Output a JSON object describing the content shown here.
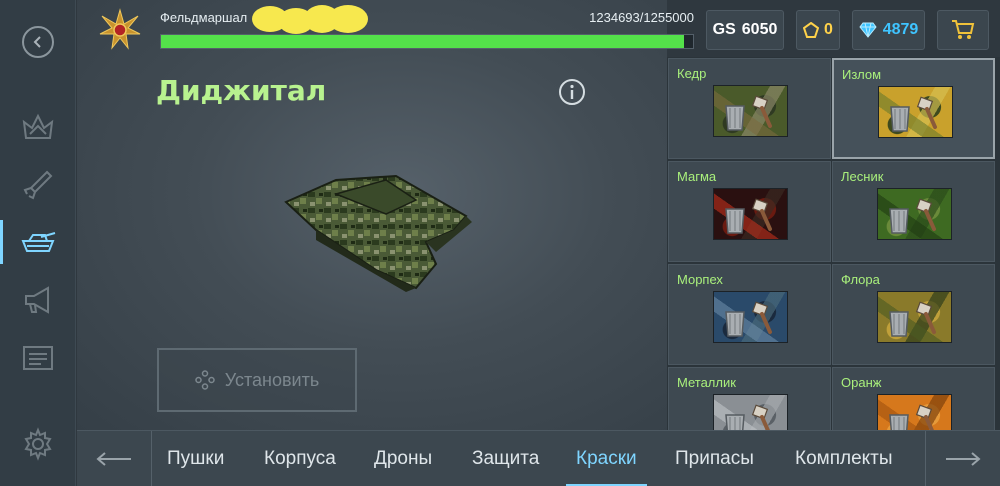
{
  "colors": {
    "accent": "#7fd5ff",
    "title": "#b8f28f",
    "paint_label": "#a9f07c",
    "xp_fill": "#54e14a",
    "crystal": "#ffd24a",
    "ruby": "#3fc4ff"
  },
  "sidebar": {
    "items": [
      {
        "icon": "back-circle-icon",
        "active": false
      },
      {
        "icon": "crown-icon",
        "active": false
      },
      {
        "icon": "rocket-icon",
        "active": false
      },
      {
        "icon": "tank-icon",
        "active": true
      },
      {
        "icon": "megaphone-icon",
        "active": false
      },
      {
        "icon": "news-icon",
        "active": false
      },
      {
        "icon": "gear-icon",
        "active": false
      }
    ]
  },
  "header": {
    "player_name": "Фельдмаршал",
    "xp_text": "1234693/1255000",
    "xp_progress": 0.9836,
    "gs_label": "GS",
    "gs_value": "6050",
    "crystals": "0",
    "rubies": "4879",
    "cart_icon": "cart-icon"
  },
  "item": {
    "title": "Диджитал",
    "install_label": "Установить"
  },
  "paints": [
    {
      "label": "Кедр",
      "palette": [
        "#4a5a2a",
        "#7a6a3e",
        "#2f3a22",
        "#8d8a6a"
      ],
      "selected": false
    },
    {
      "label": "Излом",
      "palette": [
        "#c9a12c",
        "#6a7a2c",
        "#3e4a1e",
        "#d6c152"
      ],
      "selected": true
    },
    {
      "label": "Магма",
      "palette": [
        "#2a1010",
        "#c0301c",
        "#6a1a10",
        "#3a2a22"
      ],
      "selected": false
    },
    {
      "label": "Лесник",
      "palette": [
        "#3e6a22",
        "#1e3a12",
        "#6a8a3a",
        "#2a4a1a"
      ],
      "selected": false
    },
    {
      "label": "Морпех",
      "palette": [
        "#2a4a6a",
        "#6a8aa6",
        "#1a2a3e",
        "#4a6a7a"
      ],
      "selected": false
    },
    {
      "label": "Флора",
      "palette": [
        "#8a7a2a",
        "#4a5a22",
        "#c0a03a",
        "#2a3a1a"
      ],
      "selected": false
    },
    {
      "label": "Металлик",
      "palette": [
        "#8a8f94",
        "#c0c4c8",
        "#5a6066",
        "#a6aaae"
      ],
      "selected": false
    },
    {
      "label": "Оранж",
      "palette": [
        "#d6781c",
        "#a0520e",
        "#e69a3a",
        "#7a3e0a"
      ],
      "selected": false
    }
  ],
  "tabs": {
    "items": [
      {
        "label": "Пушки",
        "active": false
      },
      {
        "label": "Корпуса",
        "active": false
      },
      {
        "label": "Дроны",
        "active": false
      },
      {
        "label": "Защита",
        "active": false
      },
      {
        "label": "Краски",
        "active": true
      },
      {
        "label": "Припасы",
        "active": false
      },
      {
        "label": "Комплекты",
        "active": false
      }
    ]
  }
}
